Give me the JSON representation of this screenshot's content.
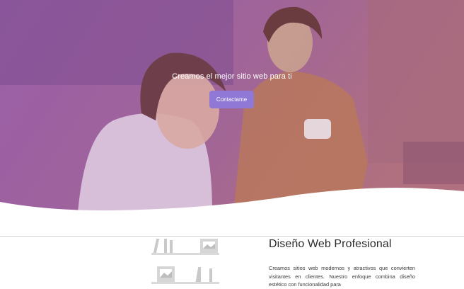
{
  "hero": {
    "title": "Creamos el mejor sitio web para ti",
    "cta_label": "Contactame",
    "overlay_color": "#9b5fae",
    "button_color": "#8f78d6"
  },
  "feature": {
    "title": "Diseño Web Profesional",
    "text": "Creamos sitios web modernos y atractivos que convierten visitantes en clientes. Nuestro enfoque combina diseño estético con funcionalidad para",
    "illustration": "gallery-illustration"
  }
}
